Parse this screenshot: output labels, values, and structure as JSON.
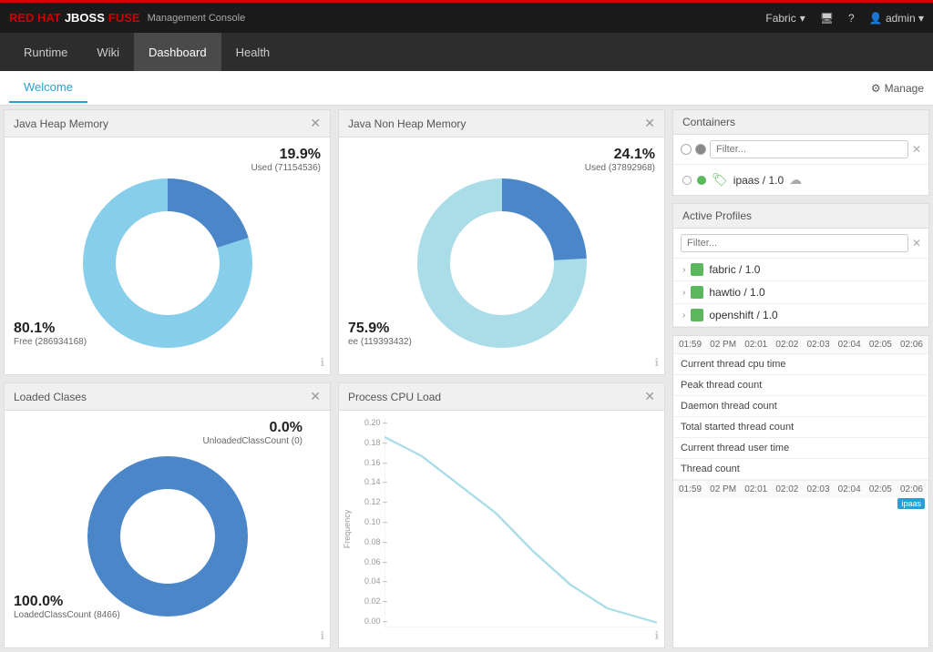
{
  "topbar": {
    "brand_red": "RED HAT",
    "brand_jboss": "JBOSS",
    "brand_fuse": "FUSE",
    "brand_mgmt": "Management Console",
    "fabric": "Fabric",
    "admin": "admin"
  },
  "mainnav": {
    "items": [
      {
        "label": "Runtime",
        "id": "runtime",
        "active": false
      },
      {
        "label": "Wiki",
        "id": "wiki",
        "active": false
      },
      {
        "label": "Dashboard",
        "id": "dashboard",
        "active": true
      },
      {
        "label": "Health",
        "id": "health",
        "active": false
      }
    ]
  },
  "tabbar": {
    "tabs": [
      {
        "label": "Welcome",
        "active": true
      }
    ],
    "manage_label": "Manage"
  },
  "java_heap": {
    "title": "Java Heap Memory",
    "used_pct": "19.9%",
    "used_label": "Used (71154536)",
    "free_pct": "80.1%",
    "free_label": "Free (286934168)",
    "used_value": 19.9,
    "free_value": 80.1
  },
  "java_nonheap": {
    "title": "Java Non Heap Memory",
    "used_pct": "24.1%",
    "used_label": "Used (37892968)",
    "free_pct": "75.9%",
    "free_label": "ee (119393432)",
    "used_value": 24.1,
    "free_value": 75.9
  },
  "loaded_classes": {
    "title": "Loaded Clases",
    "unloaded_pct": "0.0%",
    "unloaded_label": "UnloadedClassCount (0)",
    "loaded_pct": "100.0%",
    "loaded_label": "LoadedClassCount (8466)",
    "unloaded_value": 0,
    "loaded_value": 100
  },
  "cpu_load": {
    "title": "Process CPU Load",
    "y_label": "Frequency",
    "y_values": [
      "0.20",
      "0.18",
      "0.16",
      "0.14",
      "0.12",
      "0.10",
      "0.08",
      "0.06",
      "0.04",
      "0.02",
      "0.00"
    ]
  },
  "containers": {
    "title": "Containers",
    "filter_placeholder": "Filter...",
    "items": [
      {
        "name": "ipaas / 1.0",
        "status": "green"
      }
    ]
  },
  "active_profiles": {
    "title": "Active Profiles",
    "filter_placeholder": "Filter...",
    "items": [
      {
        "label": "fabric / 1.0"
      },
      {
        "label": "hawtio / 1.0"
      },
      {
        "label": "openshift / 1.0"
      }
    ]
  },
  "metrics": {
    "timeline_labels": [
      "01:59",
      "02 PM",
      "02:01",
      "02:02",
      "02:03",
      "02:04",
      "02:05",
      "02:06"
    ],
    "rows": [
      "Current thread cpu time",
      "Peak thread count",
      "Daemon thread count",
      "Total started thread count",
      "Current thread user time",
      "Thread count"
    ],
    "ipaas_badge": "ipaas"
  }
}
